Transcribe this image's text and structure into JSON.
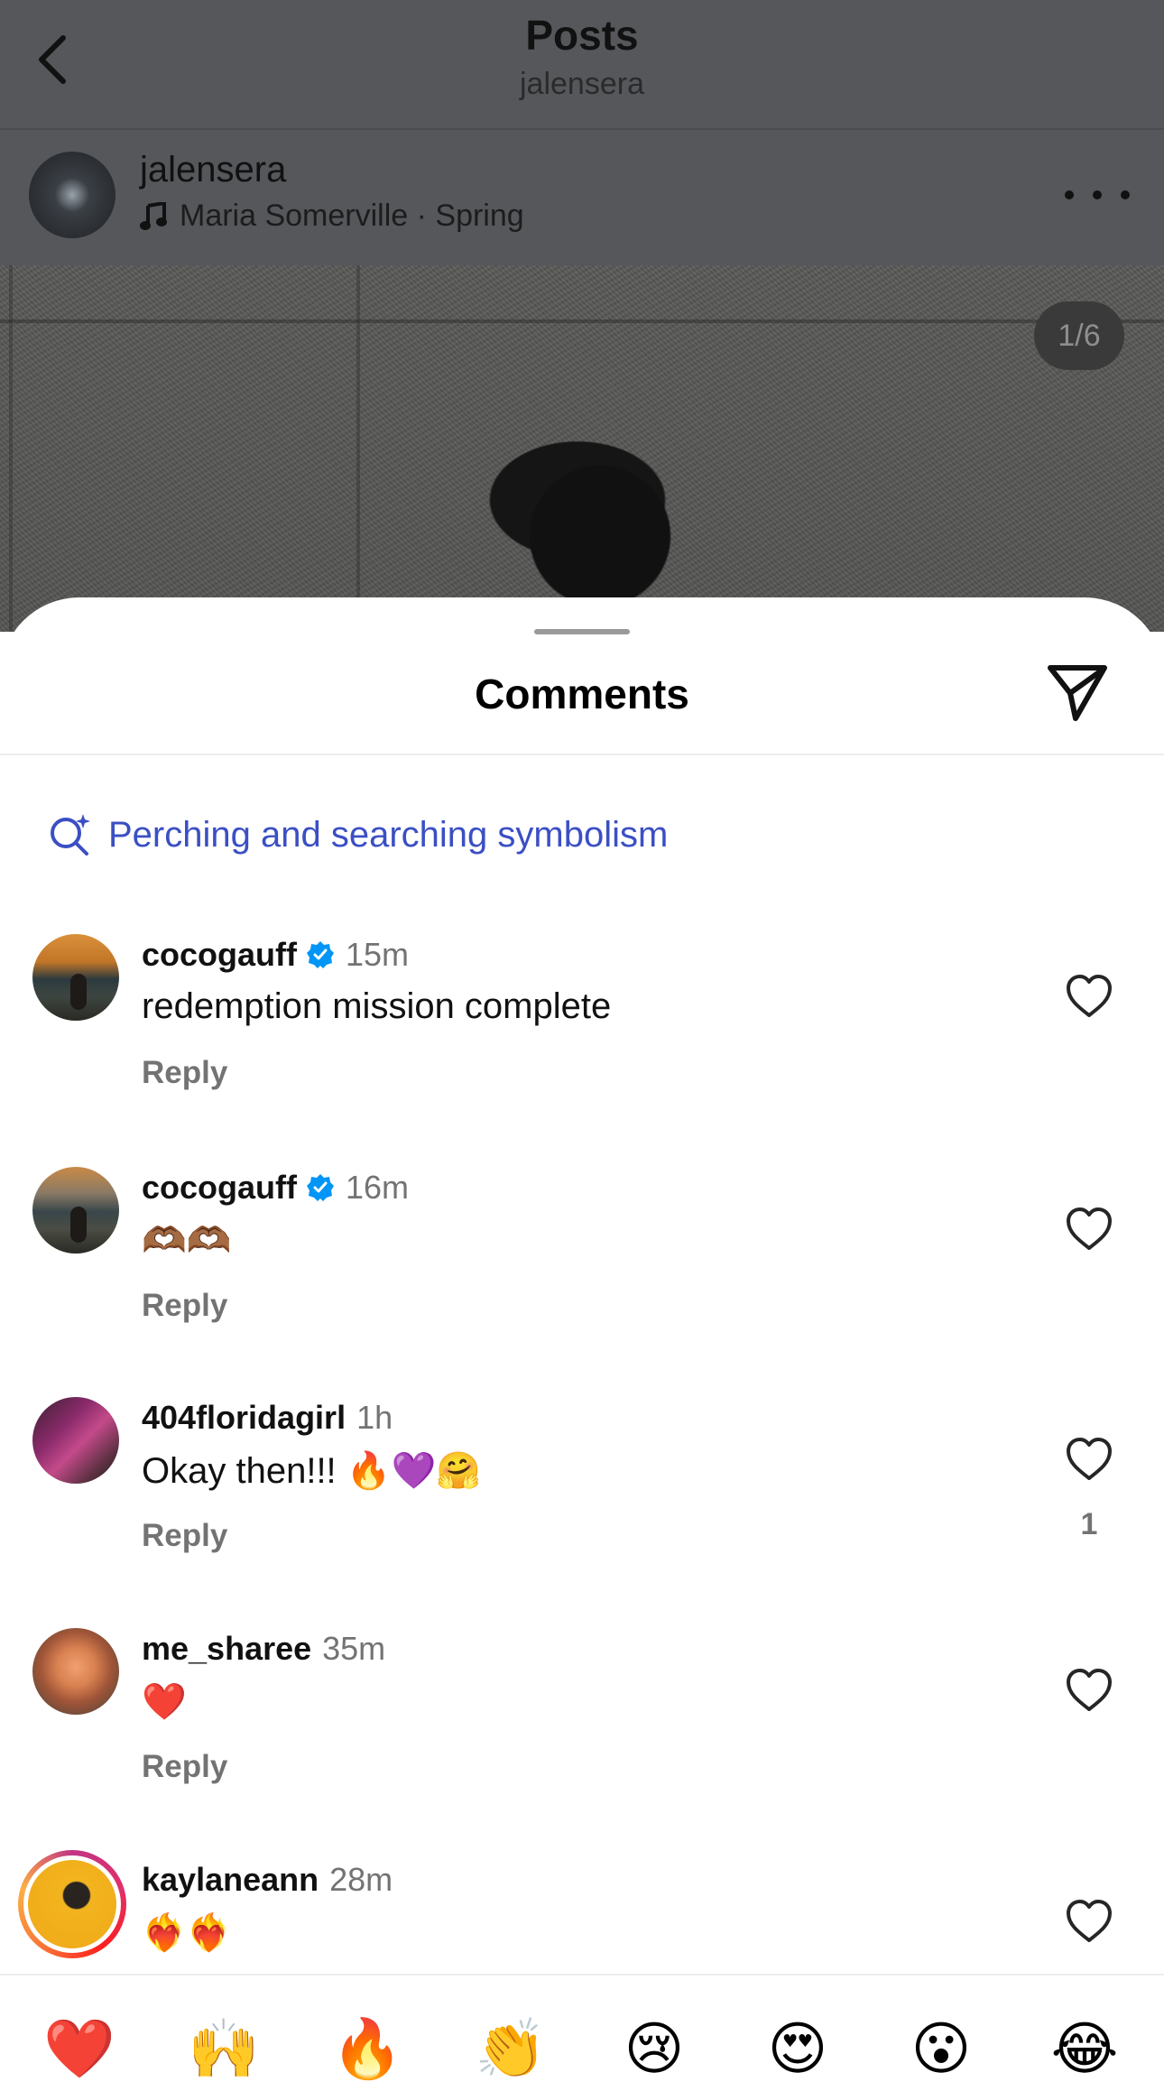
{
  "header": {
    "title": "Posts",
    "subtitle": "jalensera"
  },
  "post": {
    "author": "jalensera",
    "music": "Maria Somerville · Spring",
    "page_counter": "1/6"
  },
  "sheet": {
    "title": "Comments",
    "ai_suggestion": "Perching and searching symbolism"
  },
  "comments": [
    {
      "username": "cocogauff",
      "verified": true,
      "time": "15m",
      "text": "redemption mission complete",
      "reply_label": "Reply",
      "likes": ""
    },
    {
      "username": "cocogauff",
      "verified": true,
      "time": "16m",
      "text": "🫶🏾🫶🏾",
      "reply_label": "Reply",
      "likes": ""
    },
    {
      "username": "404floridagirl",
      "verified": false,
      "time": "1h",
      "text": "Okay then!!! 🔥💜🤗",
      "reply_label": "Reply",
      "likes": "1"
    },
    {
      "username": "me_sharee",
      "verified": false,
      "time": "35m",
      "text": "❤️",
      "reply_label": "Reply",
      "likes": ""
    },
    {
      "username": "kaylaneann",
      "verified": false,
      "time": "28m",
      "text": "❤️‍🔥❤️‍🔥",
      "reply_label": "",
      "likes": ""
    }
  ],
  "quick_reactions": [
    "❤️",
    "🙌",
    "🔥",
    "👏",
    "😢",
    "😍",
    "😮",
    "😂"
  ],
  "colors": {
    "accent_blue": "#3b4fc4",
    "verified_blue": "#0095f6",
    "dim_overlay": "#55575b",
    "muted_text": "#737373"
  }
}
